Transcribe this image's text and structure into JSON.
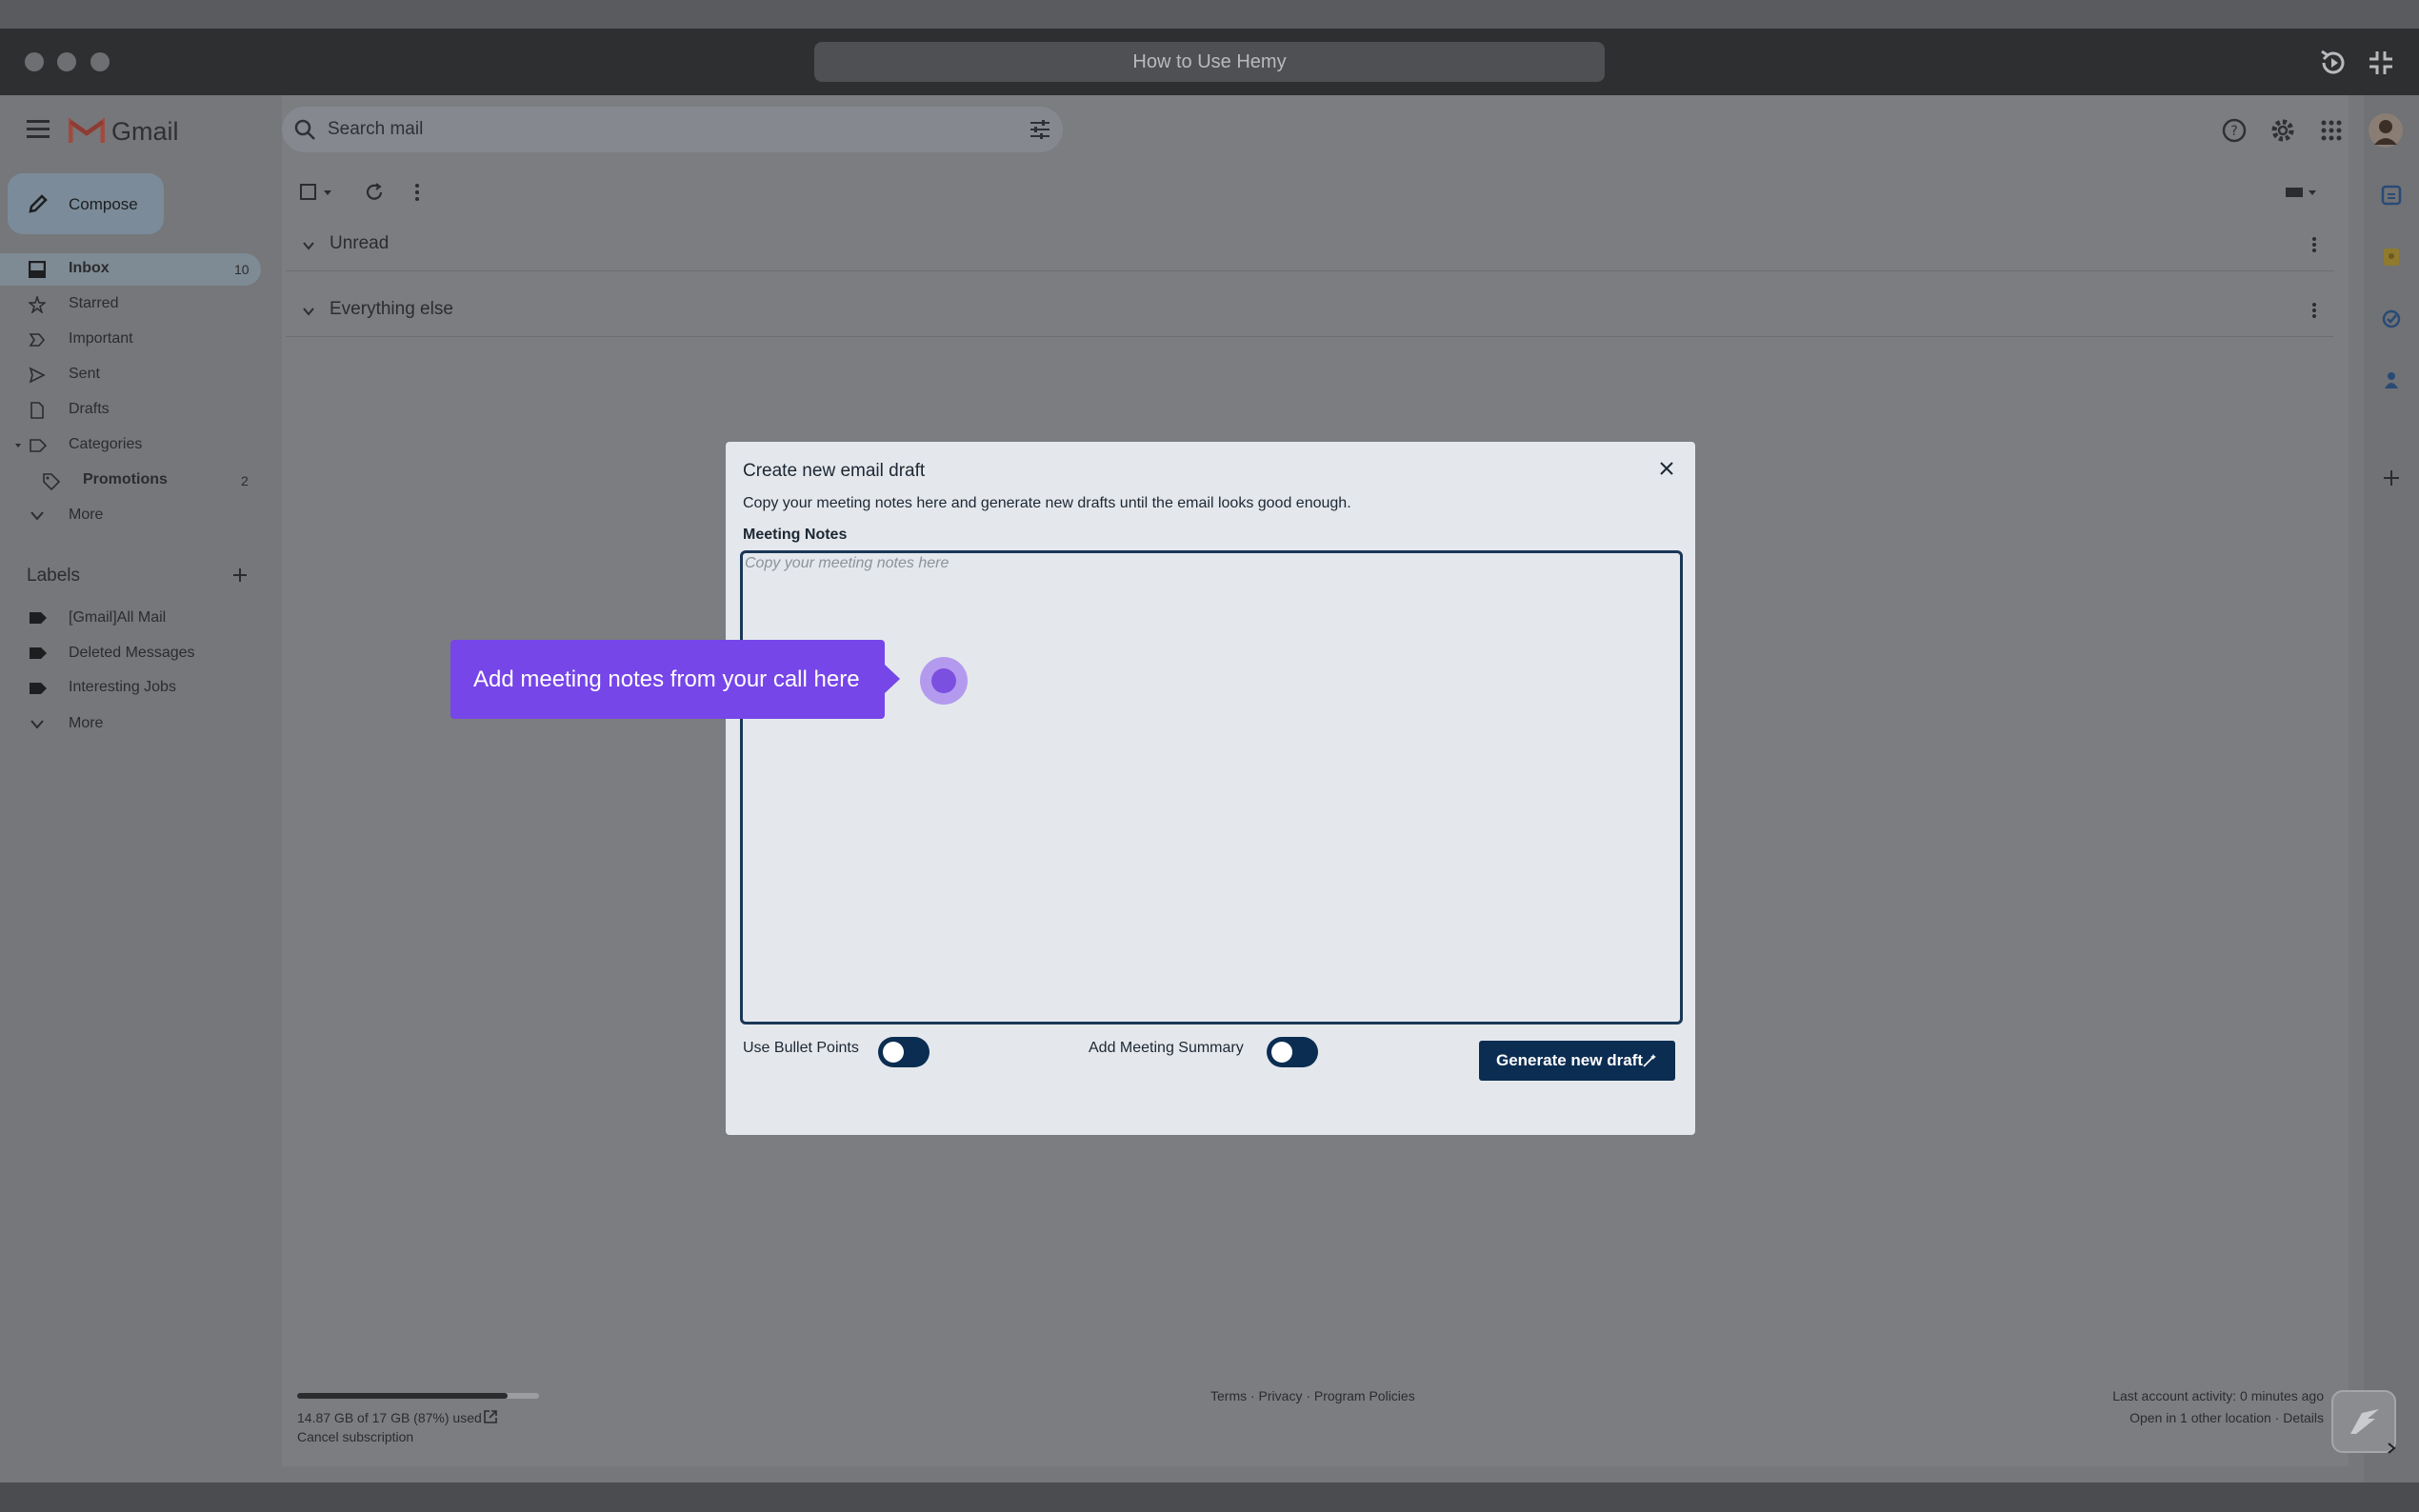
{
  "window": {
    "title": "How to Use Hemy"
  },
  "gmail": {
    "app_name": "Gmail",
    "search": {
      "placeholder": "Search mail"
    },
    "compose_label": "Compose",
    "nav": [
      {
        "label": "Inbox",
        "count": "10",
        "active": true,
        "icon": "inbox-icon"
      },
      {
        "label": "Starred",
        "icon": "star-icon"
      },
      {
        "label": "Important",
        "icon": "important-icon"
      },
      {
        "label": "Sent",
        "icon": "send-icon"
      },
      {
        "label": "Drafts",
        "icon": "draft-icon"
      },
      {
        "label": "Categories",
        "icon": "label-icon"
      },
      {
        "label": "Promotions",
        "count": "2",
        "icon": "tag-icon"
      },
      {
        "label": "More",
        "icon": "chevron-down-icon"
      }
    ],
    "labels_header": "Labels",
    "labels": [
      {
        "label": "[Gmail]All Mail"
      },
      {
        "label": "Deleted Messages"
      },
      {
        "label": "Interesting Jobs"
      },
      {
        "label": "More"
      }
    ],
    "sections": [
      {
        "title": "Unread"
      },
      {
        "title": "Everything else"
      }
    ],
    "footer": {
      "storage": "14.87 GB of 17 GB (87%) used",
      "storage_fraction": 0.87,
      "cancel": "Cancel subscription",
      "terms": "Terms · Privacy · Program Policies",
      "activity": "Last account activity: 0 minutes ago",
      "details": "Open in 1 other location · Details"
    }
  },
  "modal": {
    "title": "Create new email draft",
    "description": "Copy your meeting notes here and generate new drafts until the email looks good enough.",
    "notes_label": "Meeting Notes",
    "notes_placeholder": "Copy your meeting notes here",
    "toggle_bullets": "Use Bullet Points",
    "toggle_summary": "Add Meeting Summary",
    "generate_button": "Generate new draft"
  },
  "tooltip": {
    "text": "Add meeting notes from your call here"
  },
  "colors": {
    "accent_purple": "#7646e8",
    "navy": "#0c2d52"
  }
}
